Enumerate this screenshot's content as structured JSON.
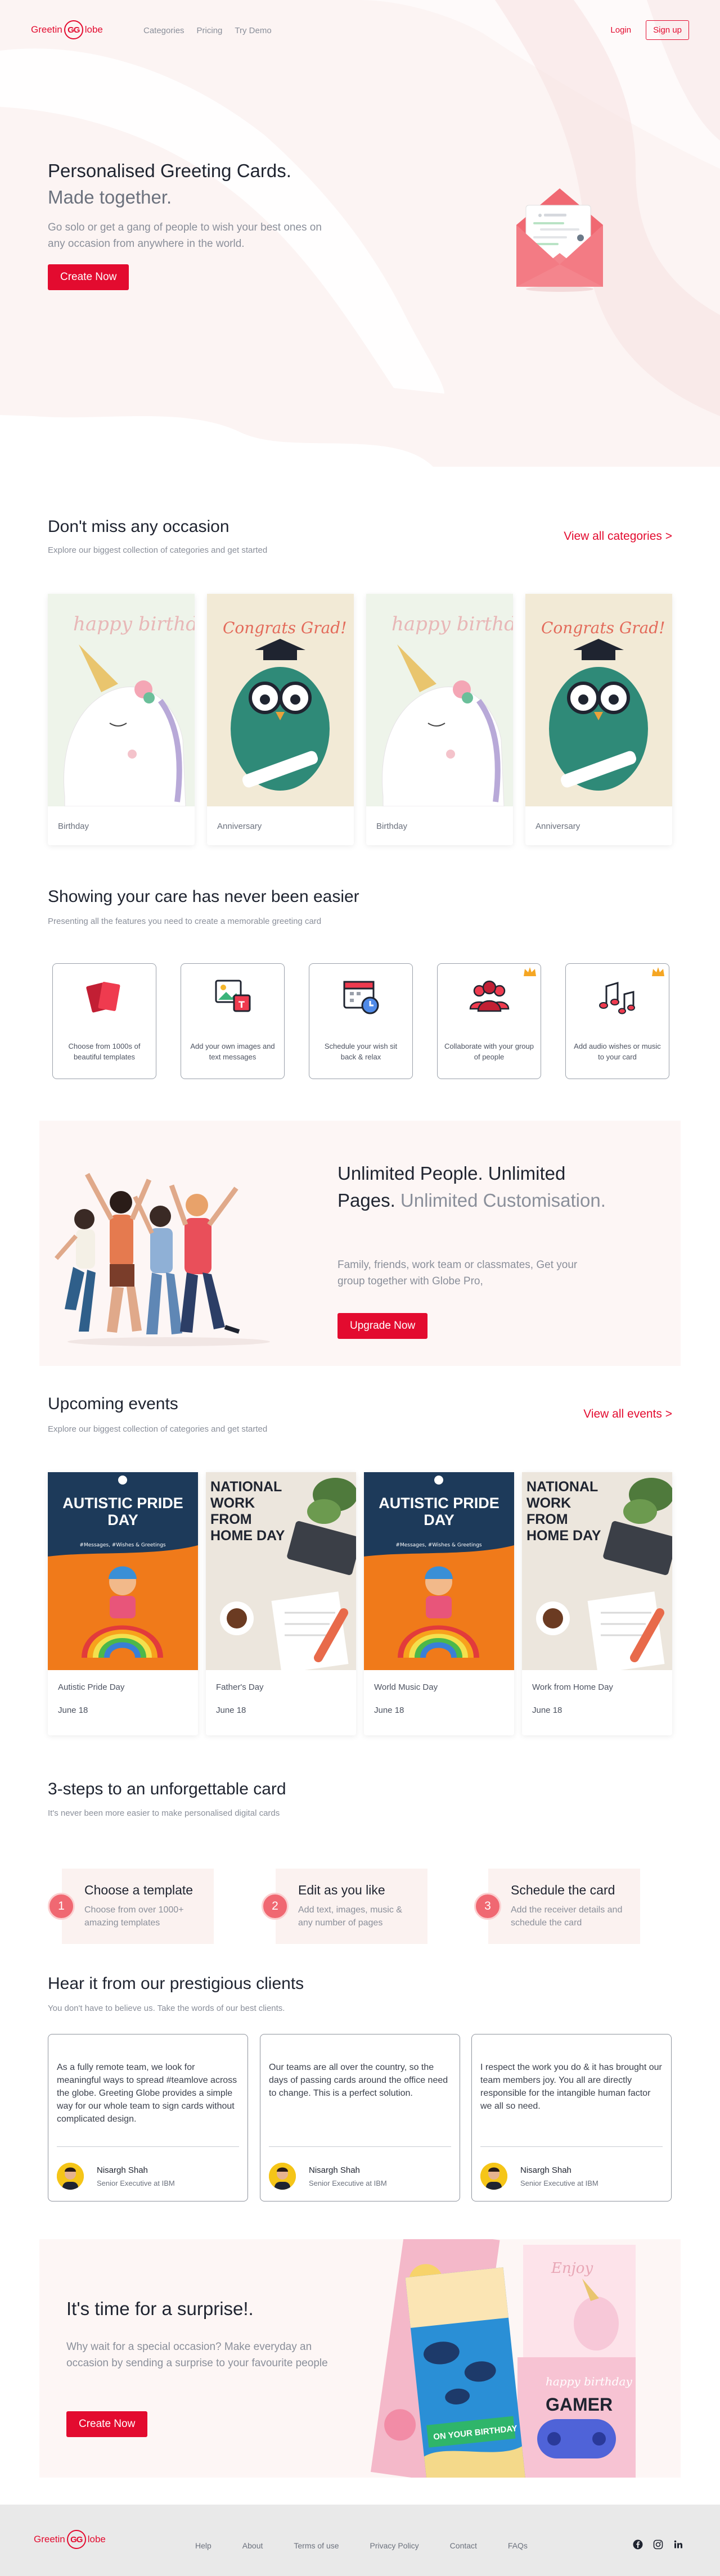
{
  "nav": {
    "logo_left": "Greetin",
    "logo_mark": "GG",
    "logo_right": "lobe",
    "links": [
      "Categories",
      "Pricing",
      "Try Demo"
    ],
    "login": "Login",
    "signup": "Sign up"
  },
  "hero": {
    "title": "Personalised Greeting Cards.",
    "subtitle": "Made together.",
    "description": "Go solo or get a gang of people to wish your best ones on any occasion from anywhere in the world.",
    "cta": "Create Now"
  },
  "occasions": {
    "title": "Don't miss any occasion",
    "subtitle": "Explore our biggest collection of categories and get started",
    "view_all": "View all categories >",
    "cards": [
      {
        "label": "Birthday",
        "art": "unicorn",
        "text": "happy birthday"
      },
      {
        "label": "Anniversary",
        "art": "owl",
        "text": "Congrats Grad!"
      },
      {
        "label": "Birthday",
        "art": "unicorn",
        "text": "happy birthday"
      },
      {
        "label": "Anniversary",
        "art": "owl",
        "text": "Congrats Grad!"
      }
    ]
  },
  "features": {
    "title": "Showing your care has never been easier",
    "subtitle": "Presenting all the features you need to create a memorable greeting card",
    "items": [
      {
        "text": "Choose from 1000s of beautiful templates",
        "icon": "cards-icon",
        "premium": false
      },
      {
        "text": "Add your own images and text messages",
        "icon": "image-text-icon",
        "premium": false
      },
      {
        "text": "Schedule your wish sit back & relax",
        "icon": "calendar-clock-icon",
        "premium": false
      },
      {
        "text": "Collaborate with your group of people",
        "icon": "group-icon",
        "premium": true
      },
      {
        "text": "Add audio wishes or music to your card",
        "icon": "music-icon",
        "premium": true
      }
    ]
  },
  "pro": {
    "title": "Unlimited People. Unlimited Pages.",
    "title_muted": "Unlimited Customisation.",
    "description": "Family, friends, work team or classmates, Get your group together with Globe Pro,",
    "cta": "Upgrade Now"
  },
  "events": {
    "title": "Upcoming events",
    "subtitle": "Explore our biggest collection of categories and get started",
    "view_all": "View all events >",
    "cards": [
      {
        "title": "Autistic Pride Day",
        "date": "June 18",
        "art": "pride",
        "poster": "AUTISTIC PRIDE DAY",
        "poster_sub": "#Messages, #Wishes & Greetings"
      },
      {
        "title": "Father's Day",
        "date": "June 18",
        "art": "wfh",
        "poster": "NATIONAL WORK FROM HOME DAY",
        "poster_sub": ""
      },
      {
        "title": "World Music Day",
        "date": "June 18",
        "art": "pride",
        "poster": "AUTISTIC PRIDE DAY",
        "poster_sub": "#Messages, #Wishes & Greetings"
      },
      {
        "title": "Work from Home Day",
        "date": "June 18",
        "art": "wfh",
        "poster": "NATIONAL WORK FROM HOME DAY",
        "poster_sub": ""
      }
    ]
  },
  "steps": {
    "title": "3-steps to an unforgettable card",
    "subtitle": "It's never been more easier to make personalised digital cards",
    "items": [
      {
        "num": "1",
        "title": "Choose a template",
        "desc": "Choose from over 1000+ amazing templates"
      },
      {
        "num": "2",
        "title": "Edit as you like",
        "desc": "Add text, images, music & any number of pages"
      },
      {
        "num": "3",
        "title": "Schedule the card",
        "desc": "Add the receiver details and schedule the card"
      }
    ]
  },
  "testimonials": {
    "title": "Hear it from our prestigious clients",
    "subtitle": "You don't have to believe us. Take the words of our best clients.",
    "items": [
      {
        "text": "As a fully remote team, we look for meaningful ways to spread #teamlove across the globe. Greeting Globe provides a simple way for our whole team to sign cards without complicated design.",
        "name": "Nisargh Shah",
        "role": "Senior Executive at IBM"
      },
      {
        "text": "Our teams are all over the country, so the days of passing cards around the office need to change. This is a perfect solution.",
        "name": "Nisargh Shah",
        "role": "Senior Executive at IBM"
      },
      {
        "text": "I respect the work you do & it has brought our team members joy. You all are directly responsible for the intangible human factor we all so need.",
        "name": "Nisargh Shah",
        "role": "Senior Executive at IBM"
      }
    ]
  },
  "surprise": {
    "title": "It's time for a surprise!.",
    "description": "Why wait for a special occasion? Make everyday an occasion by sending a surprise to your favourite people",
    "cta": "Create Now",
    "card_texts": [
      "Enjoy",
      "happy birthday",
      "GAMER",
      "ON YOUR BIRTHDAY"
    ]
  },
  "footer": {
    "logo_left": "Greetin",
    "logo_mark": "GG",
    "logo_right": "lobe",
    "links": [
      "Help",
      "About",
      "Terms of use",
      "Privacy Policy",
      "Contact",
      "FAQs"
    ],
    "social": [
      "facebook-icon",
      "instagram-icon",
      "linkedin-icon"
    ]
  },
  "colors": {
    "brand_red": "#e30b2f",
    "soft_bg": "#fdf6f5",
    "step_bg": "#fbf2f0",
    "step_circle": "#f06872",
    "footer_bg": "#e9e9e9"
  }
}
